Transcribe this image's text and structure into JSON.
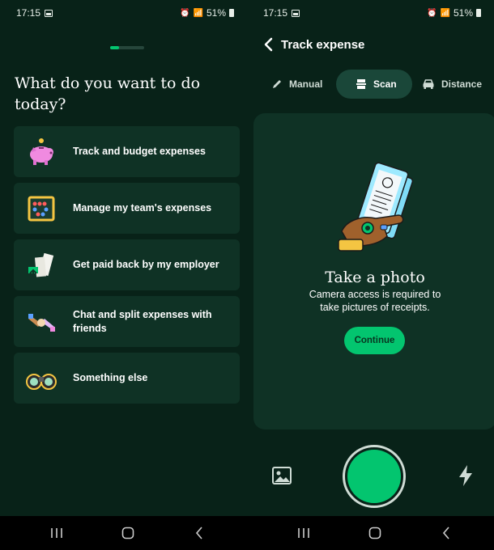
{
  "left": {
    "status": {
      "time": "17:15",
      "battery": "51%"
    },
    "onboarding_progress": 0.25,
    "question": "What do you want to do today?",
    "options": [
      {
        "label": "Track and budget expenses",
        "icon": "piggy-bank-icon"
      },
      {
        "label": "Manage my team's expenses",
        "icon": "abacus-icon"
      },
      {
        "label": "Get paid back by my employer",
        "icon": "receipts-arrow-icon"
      },
      {
        "label": "Chat and split expenses with friends",
        "icon": "handshake-icon"
      },
      {
        "label": "Something else",
        "icon": "binoculars-icon"
      }
    ]
  },
  "right": {
    "status": {
      "time": "17:15",
      "battery": "51%"
    },
    "header": {
      "title": "Track expense",
      "back_icon": "chevron-left-icon"
    },
    "tabs": [
      {
        "label": "Manual",
        "icon": "pencil-icon",
        "active": false
      },
      {
        "label": "Scan",
        "icon": "scan-icon",
        "active": true
      },
      {
        "label": "Distance",
        "icon": "car-icon",
        "active": false
      }
    ],
    "panel": {
      "title": "Take a photo",
      "description": "Camera access is required to take pictures of receipts.",
      "button": "Continue"
    },
    "camera": {
      "gallery_icon": "image-icon",
      "flash_icon": "flash-icon"
    }
  },
  "colors": {
    "background": "#082218",
    "card": "#0f3225",
    "accent": "#03c56f",
    "active_tab": "#1a4739"
  }
}
